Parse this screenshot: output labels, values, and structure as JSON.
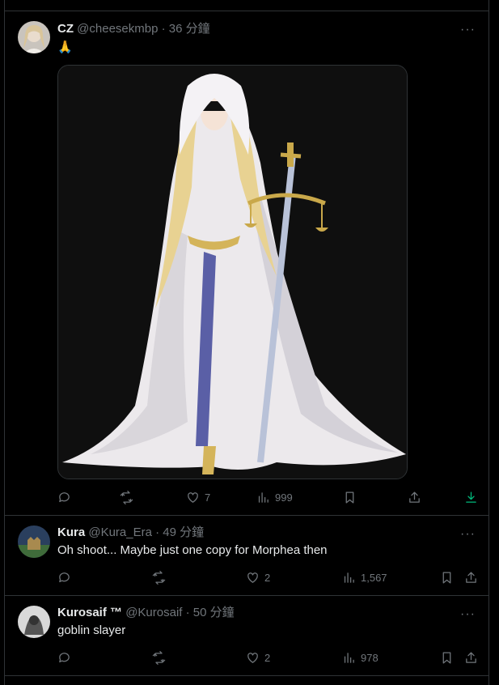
{
  "tweets": [
    {
      "name": "CZ",
      "handle": "@cheesekmbp",
      "time": "· 36 分鐘",
      "text": "🙏",
      "media_alt": "anime priestess illustration",
      "replies": "",
      "retweets": "",
      "likes": "7",
      "views": "999"
    },
    {
      "name": "Kura",
      "handle": "@Kura_Era",
      "time": "· 49 分鐘",
      "text": "Oh shoot... Maybe just one copy for Morphea then",
      "replies": "",
      "retweets": "",
      "likes": "2",
      "views": "1,567"
    },
    {
      "name": "Kurosaif ™",
      "handle": "@Kurosaif",
      "time": "· 50 分鐘",
      "text": "goblin slayer",
      "replies": "",
      "retweets": "",
      "likes": "2",
      "views": "978"
    }
  ],
  "more_label": "···",
  "colors": {
    "background": "#000000",
    "border": "#2f3336",
    "muted": "#71767b",
    "text": "#e7e9ea",
    "download": "#00ba7c"
  }
}
